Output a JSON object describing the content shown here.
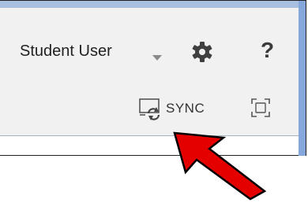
{
  "header": {
    "user_name": "Student User",
    "sync_label": "SYNC"
  },
  "icons": {
    "user_menu": "chevron-down-icon",
    "settings": "gear-icon",
    "help": "help-icon",
    "help_glyph": "?",
    "sync": "sync-icon",
    "fullscreen": "fullscreen-icon",
    "annotation": "red-arrow-icon"
  },
  "colors": {
    "accent_strip": "#86a7dc",
    "panel_bg": "#f1f1f1",
    "arrow_fill": "#e50000"
  }
}
